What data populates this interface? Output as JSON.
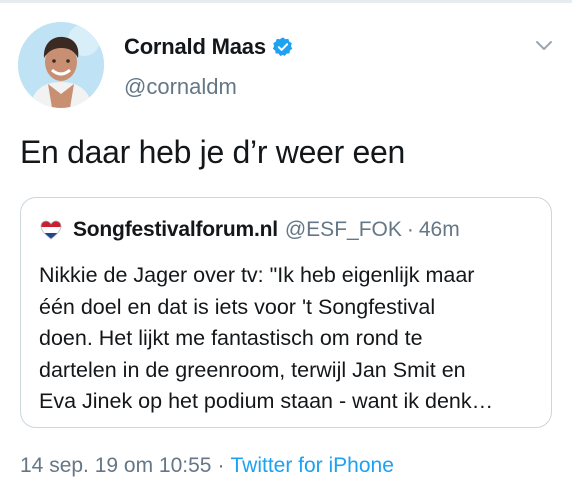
{
  "colors": {
    "verified_blue": "#1da1f2",
    "secondary_text": "#657786",
    "link": "#1da1f2",
    "border": "#ccd6dd"
  },
  "author": {
    "name": "Cornald Maas",
    "handle": "@cornaldm",
    "verified": true,
    "avatar": "profile-photo",
    "menu_icon": "chevron-down-icon"
  },
  "tweet": {
    "text": "En daar heb je d’r weer een"
  },
  "quoted_tweet": {
    "logo": "heart-flag-logo",
    "name": "Songfestivalforum.nl",
    "handle": "@ESF_FOK",
    "separator": "·",
    "time": "46m",
    "lines": [
      "Nikkie de Jager over tv: \"Ik heb eigenlijk maar",
      "één doel en dat is iets voor 't Songfestival",
      "doen. Het lijkt me fantastisch om rond te",
      "dartelen in de greenroom, terwijl Jan Smit en",
      "Eva Jinek op het podium staan - want ik denk…"
    ]
  },
  "footer": {
    "date": "14 sep. 19 om 10:55",
    "separator": "·",
    "source": "Twitter for iPhone"
  }
}
